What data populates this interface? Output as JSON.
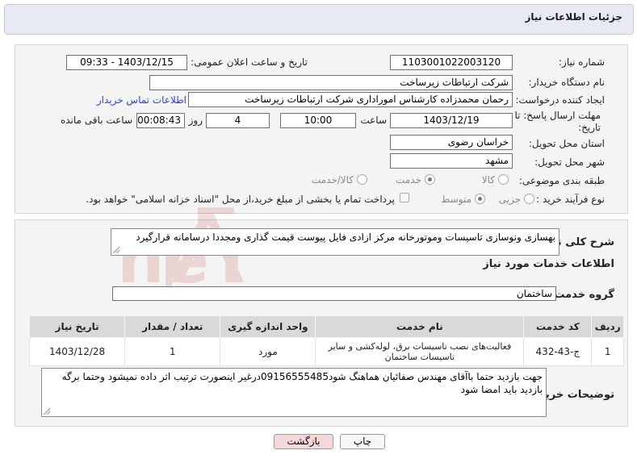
{
  "header": {
    "title": "جزئیات اطلاعات نیاز"
  },
  "form": {
    "need_number_label": "شماره نیاز:",
    "need_number": "1103001022003120",
    "announce_datetime_label": "تاریخ و ساعت اعلان عمومی:",
    "announce_datetime": "1403/12/15 - 09:33",
    "buyer_org_label": "نام دستگاه خریدار:",
    "buyer_org": "شرکت ارتباطات زیرساخت",
    "requester_label": "ایجاد کننده درخواست:",
    "requester": "رحمان محمدزاده کارشناس امورادارى  شرکت ارتباطات زیرساخت",
    "buyer_contact_link": "اطلاعات تماس خریدار",
    "deadline_label_line1": "مهلت ارسال پاسخ: تا",
    "deadline_label_line2": "تاریخ:",
    "deadline_date": "1403/12/19",
    "time_label": "ساعت",
    "deadline_time": "10:00",
    "days_value": "4",
    "days_label": "روز و",
    "remaining_time": "00:08:43",
    "remaining_label": "ساعت باقی مانده",
    "province_label": "استان محل تحویل:",
    "province": "خراسان رضوی",
    "city_label": "شهر محل تحویل:",
    "city": "مشهد",
    "category_label": "طبقه بندی موضوعی:",
    "category_options": [
      "کالا",
      "خدمت",
      "کالا/خدمت"
    ],
    "category_selected": "خدمت",
    "process_label": "نوع فرآیند خرید :",
    "process_options": [
      "جزیی",
      "متوسط"
    ],
    "process_selected": "جزیی",
    "payment_note": "پرداخت تمام یا بخشی از مبلغ خرید،از محل \"اسناد خزانه اسلامی\" خواهد بود."
  },
  "summary": {
    "label": "شرح کلی نیاز:",
    "text": "بهسازی ونوسازی تاسیسات وموتورخانه مرکز ازادی فایل پیوست قیمت گذاری ومجددا درسامانه قرارگیرد"
  },
  "services": {
    "section_title": "اطلاعات خدمات مورد نیاز",
    "group_label": "گروه خدمت:",
    "group_value": "ساختمان",
    "columns": [
      "ردیف",
      "کد خدمت",
      "نام خدمت",
      "واحد اندازه گیری",
      "تعداد / مقدار",
      "تاریخ نیاز"
    ],
    "rows": [
      [
        "1",
        "ج-43-432",
        "فعالیت‌های نصب تاسیسات برق، لوله‌کشی و سایر تاسیسات ساختمان",
        "مورد",
        "1",
        "1403/12/28"
      ]
    ]
  },
  "buyer_notes": {
    "label": "توضیحات خریدار:",
    "text": "جهت بازدید حتما باآقای مهندس صفائیان هماهنگ شود09156555485درغیر اینصورت ترتیب اثر داده نمیشود وحتما برگه بازدید باید امضا شود"
  },
  "buttons": {
    "print": "چاپ",
    "back": "بازگشت"
  },
  "watermark_text": "AriaTender.neT",
  "colors": {
    "link": "#2746c9",
    "header_bg": "#e8eaf3",
    "back_button_bg": "#f6d8d8",
    "watermark": "#c0392b"
  }
}
